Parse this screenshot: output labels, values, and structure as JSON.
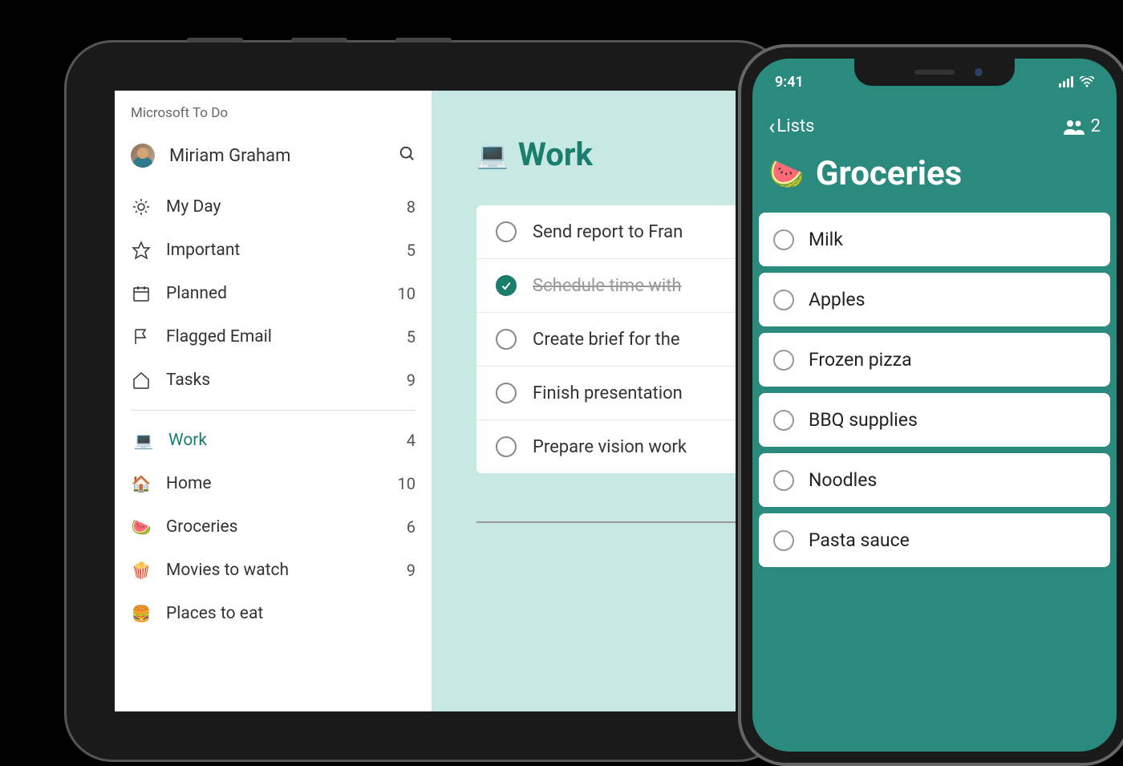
{
  "tablet": {
    "app_title": "Microsoft To Do",
    "user_name": "Miriam Graham",
    "smart_lists": [
      {
        "icon": "sun",
        "label": "My Day",
        "count": "8"
      },
      {
        "icon": "star",
        "label": "Important",
        "count": "5"
      },
      {
        "icon": "calendar",
        "label": "Planned",
        "count": "10"
      },
      {
        "icon": "flag",
        "label": "Flagged Email",
        "count": "5"
      },
      {
        "icon": "home",
        "label": "Tasks",
        "count": "9"
      }
    ],
    "custom_lists": [
      {
        "icon": "💻",
        "label": "Work",
        "count": "4",
        "active": true
      },
      {
        "icon": "🏠",
        "label": "Home",
        "count": "10"
      },
      {
        "icon": "🍉",
        "label": "Groceries",
        "count": "6"
      },
      {
        "icon": "🍿",
        "label": "Movies to watch",
        "count": "9"
      },
      {
        "icon": "🍔",
        "label": "Places to eat",
        "count": ""
      }
    ],
    "main": {
      "list_icon": "💻",
      "list_title": "Work",
      "tasks": [
        {
          "text": "Send report to Fran",
          "completed": false
        },
        {
          "text": "Schedule time with",
          "completed": true
        },
        {
          "text": "Create brief for the",
          "completed": false
        },
        {
          "text": "Finish presentation",
          "completed": false
        },
        {
          "text": "Prepare vision work",
          "completed": false
        }
      ]
    }
  },
  "phone": {
    "status_time": "9:41",
    "back_label": "Lists",
    "share_count": "2",
    "list_icon": "🍉",
    "list_title": "Groceries",
    "tasks": [
      {
        "text": "Milk"
      },
      {
        "text": "Apples"
      },
      {
        "text": "Frozen pizza"
      },
      {
        "text": "BBQ supplies"
      },
      {
        "text": "Noodles"
      },
      {
        "text": "Pasta sauce"
      }
    ]
  }
}
